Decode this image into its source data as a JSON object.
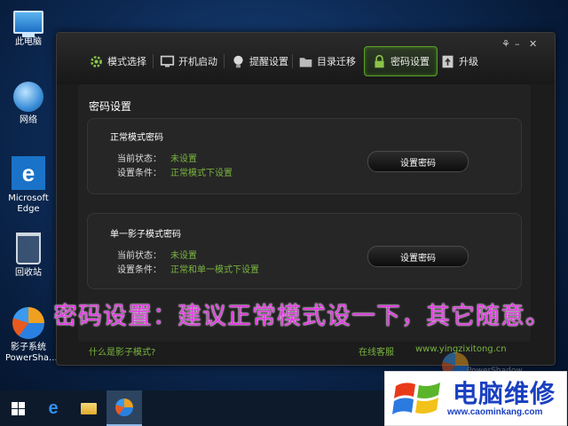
{
  "desktop": {
    "icons": [
      {
        "label": "此电脑"
      },
      {
        "label": "网络"
      },
      {
        "label": "Microsoft Edge"
      },
      {
        "label": "回收站"
      },
      {
        "label": "影子系统 PowerSha..."
      }
    ]
  },
  "window": {
    "controls": {
      "mode": "⚘",
      "minimize": "–",
      "close": "✕"
    },
    "tabs": [
      {
        "label": "模式选择",
        "icon": "gear-icon"
      },
      {
        "label": "开机启动",
        "icon": "monitor-icon"
      },
      {
        "label": "提醒设置",
        "icon": "lightbulb-icon"
      },
      {
        "label": "目录迁移",
        "icon": "folder-icon"
      },
      {
        "label": "密码设置",
        "icon": "lock-icon",
        "active": true
      },
      {
        "label": "升级",
        "icon": "upgrade-icon"
      }
    ],
    "section_title": "密码设置",
    "panels": [
      {
        "title": "正常模式密码",
        "status_label": "当前状态：",
        "status_value": "未设置",
        "condition_label": "设置条件：",
        "condition_value": "正常模式下设置",
        "button": "设置密码"
      },
      {
        "title": "单一影子模式密码",
        "status_label": "当前状态：",
        "status_value": "未设置",
        "condition_label": "设置条件：",
        "condition_value": "正常和单一模式下设置",
        "button": "设置密码"
      }
    ],
    "footer": {
      "help_link": "什么是影子模式?",
      "support_link": "在线客服",
      "website": "www.yingzixitong.cn"
    },
    "ghost_brand": "PowerShadow 8.5"
  },
  "overlay_caption": "密码设置：建议正常模式设一下，其它随意。",
  "watermark": {
    "title": "电脑维修",
    "url": "www.caominkang.com"
  },
  "colors": {
    "accent_green": "#7ab540",
    "caption_magenta": "#e040e0",
    "watermark_blue": "#1a40c0"
  }
}
